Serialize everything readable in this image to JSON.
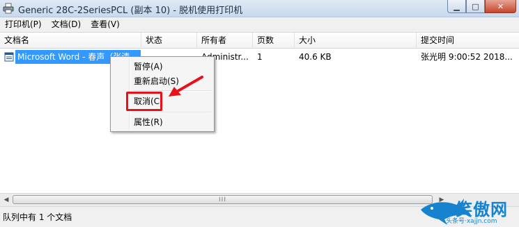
{
  "window": {
    "title": "Generic 28C-2SeriesPCL (副本 10) - 脱机使用打印机",
    "minimize_glyph": "▁",
    "maximize_glyph": "□",
    "close_glyph": "✕"
  },
  "menu": [
    "打印机(P)",
    "文档(D)",
    "查看(V)"
  ],
  "columns": [
    "文档名",
    "状态",
    "所有者",
    "页数",
    "大小",
    "提交时间"
  ],
  "jobs": [
    {
      "name": "Microsoft Word - 春声（张清",
      "status": "",
      "owner": "Administr...",
      "pages": "1",
      "size": "40.6 KB",
      "submitted": "张光明 9:00:52   2018..."
    }
  ],
  "context_menu": {
    "pause": "暂停(A)",
    "restart": "重新启动(S)",
    "cancel": "取消(C",
    "properties": "属性(R)"
  },
  "scrollbar": {
    "left_arrow": "◀",
    "right_arrow": "▶",
    "thumb_grip": "III"
  },
  "status": "队列中有 1 个文档",
  "watermark": {
    "text": "笑傲网",
    "sub": "头条号·xajjn.com"
  },
  "colors": {
    "selection": "#3399ff",
    "highlight_box": "#e8111a",
    "arrow": "#e8111a",
    "watermark": "#1783cf"
  },
  "icons": [
    "printer-icon",
    "document-icon",
    "red-arrow-icon",
    "shark-logo-icon"
  ]
}
